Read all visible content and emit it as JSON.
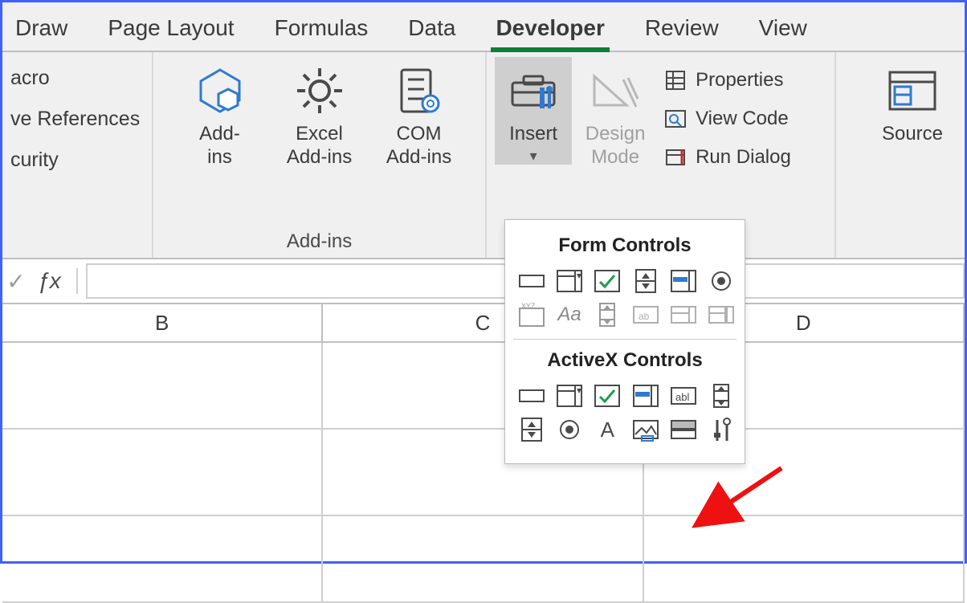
{
  "tabs": [
    "Draw",
    "Page Layout",
    "Formulas",
    "Data",
    "Developer",
    "Review",
    "View"
  ],
  "active_tab_index": 4,
  "code_group": {
    "items": [
      "acro",
      "ve References",
      "curity"
    ]
  },
  "addins_group": {
    "label": "Add-ins",
    "buttons": [
      {
        "line1": "Add-",
        "line2": "ins"
      },
      {
        "line1": "Excel",
        "line2": "Add-ins"
      },
      {
        "line1": "COM",
        "line2": "Add-ins"
      }
    ]
  },
  "controls_group": {
    "insert": {
      "label": "Insert"
    },
    "design_mode": {
      "line1": "Design",
      "line2": "Mode"
    },
    "extras": [
      "Properties",
      "View Code",
      "Run Dialog"
    ]
  },
  "xml_group": {
    "source": "Source"
  },
  "columns": [
    "B",
    "C",
    "D"
  ],
  "formula_value": "",
  "dropdown": {
    "form_title": "Form Controls",
    "activex_title": "ActiveX Controls",
    "form_controls": [
      "button",
      "combo-box",
      "check-box",
      "spin-button",
      "list-box",
      "option-button",
      "group-box",
      "label",
      "scroll-bar",
      "text-field",
      "combo-list",
      "combo-drop"
    ],
    "activex_controls": [
      "command-button",
      "combo-box",
      "check-box",
      "list-box",
      "text-box",
      "scroll-bar",
      "spin-button",
      "option-button",
      "label",
      "image",
      "toggle-button",
      "more-controls"
    ]
  }
}
